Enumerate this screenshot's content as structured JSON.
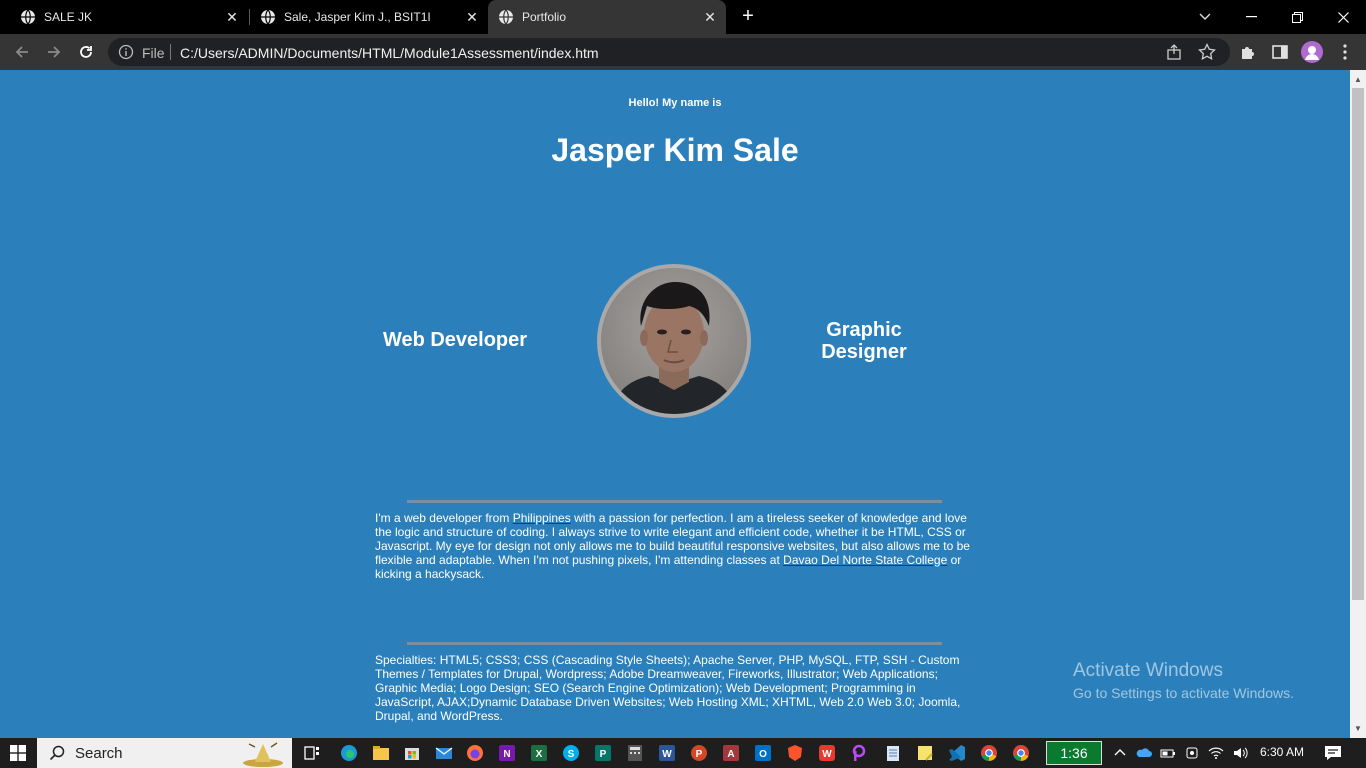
{
  "browser": {
    "tabs": [
      {
        "title": "SALE JK",
        "active": false
      },
      {
        "title": "Sale, Jasper Kim J., BSIT1I",
        "active": false
      },
      {
        "title": "Portfolio",
        "active": true
      }
    ],
    "address": {
      "scheme_label": "File",
      "url": "C:/Users/ADMIN/Documents/HTML/Module1Assessment/index.htm"
    }
  },
  "page": {
    "greeting": "Hello! My name is",
    "name": "Jasper Kim Sale",
    "role_left": "Web Developer",
    "role_right": "Graphic Designer",
    "about": {
      "text_1": "I'm a web developer from ",
      "link_1": "Philippines",
      "text_2": " with a passion for perfection. I am a tireless seeker of knowledge and love the logic and structure of coding. I always strive to write elegant and efficient code, whether it be HTML, CSS or Javascript. My eye for design not only allows me to build beautiful responsive websites, but also allows me to be flexible and adaptable. When I'm not pushing pixels, I'm attending classes at ",
      "link_2": "Davao Del Norte State College",
      "text_3": " or kicking a hackysack."
    },
    "specialties": "Specialties: HTML5; CSS3; CSS (Cascading Style Sheets); Apache Server, PHP, MySQL, FTP, SSH - Custom Themes / Templates for Drupal, Wordpress; Adobe Dreamweaver, Fireworks, Illustrator; Web Applications; Graphic Media; Logo Design; SEO (Search Engine Optimization); Web Development; Programming in JavaScript, AJAX;Dynamic Database Driven Websites; Web Hosting XML; XHTML, Web 2.0 Web 3.0; Joomla, Drupal, and WordPress."
  },
  "watermark": {
    "title": "Activate Windows",
    "subtitle": "Go to Settings to activate Windows."
  },
  "taskbar": {
    "search_label": "Search",
    "timer": "1:36",
    "clock": "6:30 AM",
    "apps": [
      "task-view",
      "edge",
      "file-explorer",
      "store",
      "mail",
      "firefox",
      "onenote",
      "excel",
      "skype",
      "publisher",
      "calculator",
      "word",
      "powerpoint",
      "access",
      "outlook",
      "brave",
      "wps",
      "picsart",
      "notepad",
      "notes",
      "vscode",
      "chrome",
      "chrome-2"
    ]
  },
  "colors": {
    "page_background": "#2b80bb",
    "tab_bar": "#000000",
    "toolbar": "#353535",
    "taskbar": "#1e1e1e",
    "timer_green": "#0a7a2e"
  }
}
